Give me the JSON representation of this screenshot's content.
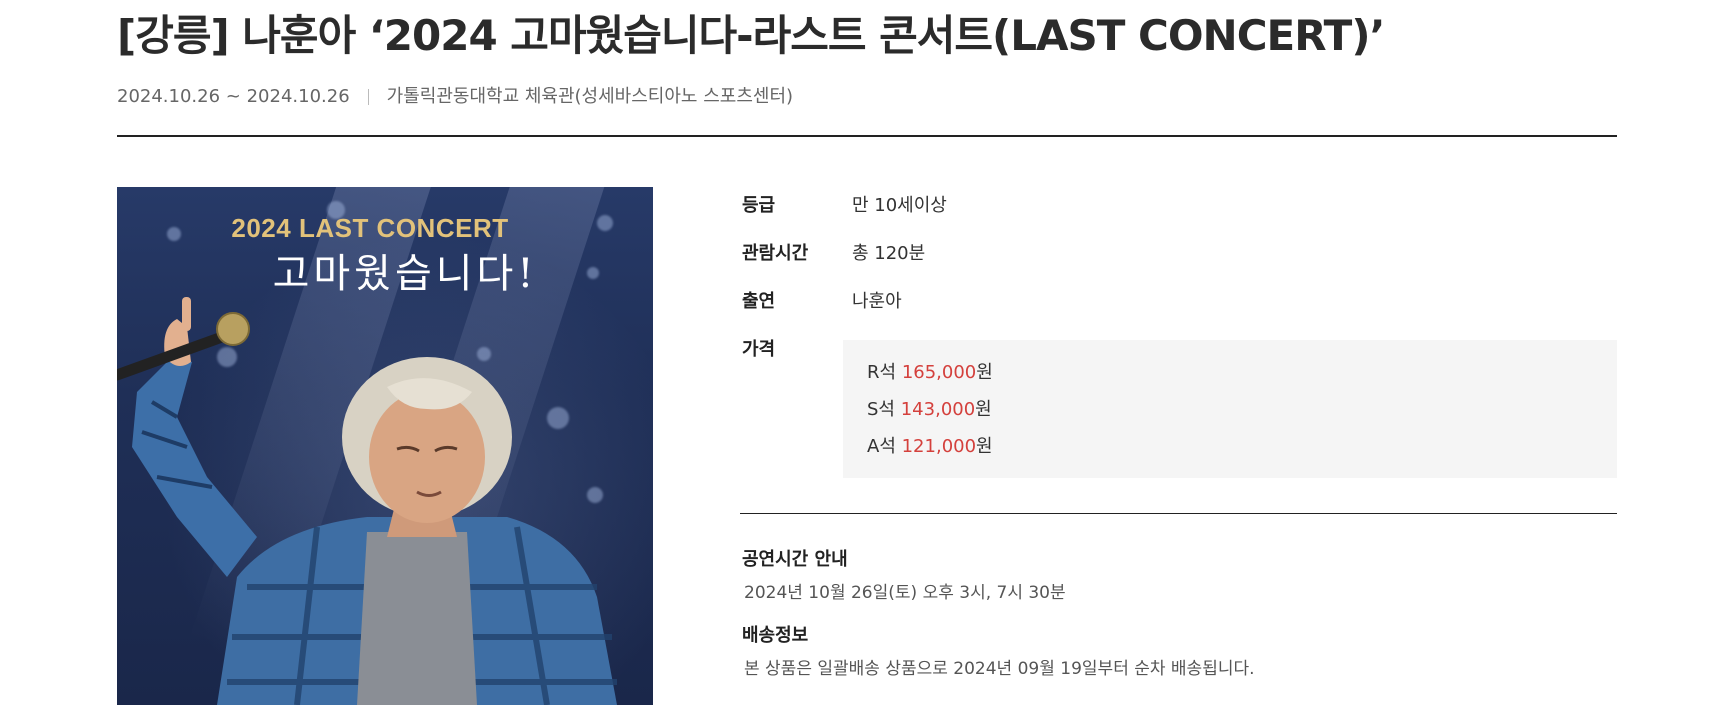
{
  "title": "[강릉] 나훈아 ‘2024 고마웠습니다-라스트 콘서트(LAST CONCERT)’",
  "meta": {
    "date_range": "2024.10.26 ~ 2024.10.26",
    "venue": "가톨릭관동대학교 체육관(성세바스티아노 스포츠센터)"
  },
  "poster": {
    "headline_en": "2024 LAST CONCERT",
    "headline_ko": "고마웠습니다!"
  },
  "info": {
    "rating": {
      "label": "등급",
      "value": "만 10세이상"
    },
    "runtime": {
      "label": "관람시간",
      "value": "총 120분"
    },
    "cast": {
      "label": "출연",
      "value": "나훈아"
    },
    "price_label": "가격",
    "prices": [
      {
        "seat": "R석",
        "amount": "165,000",
        "unit": "원"
      },
      {
        "seat": "S석",
        "amount": "143,000",
        "unit": "원"
      },
      {
        "seat": "A석",
        "amount": "121,000",
        "unit": "원"
      }
    ]
  },
  "schedule": {
    "title": "공연시간 안내",
    "text": "2024년 10월 26일(토) 오후 3시, 7시 30분"
  },
  "delivery": {
    "title": "배송정보",
    "text": "본 상품은 일괄배송 상품으로 2024년 09월 19일부터 순차 배송됩니다."
  },
  "colors": {
    "price_accent": "#d4403c",
    "price_box_bg": "#f5f5f5",
    "poster_title_gold": "#e2c27a"
  }
}
